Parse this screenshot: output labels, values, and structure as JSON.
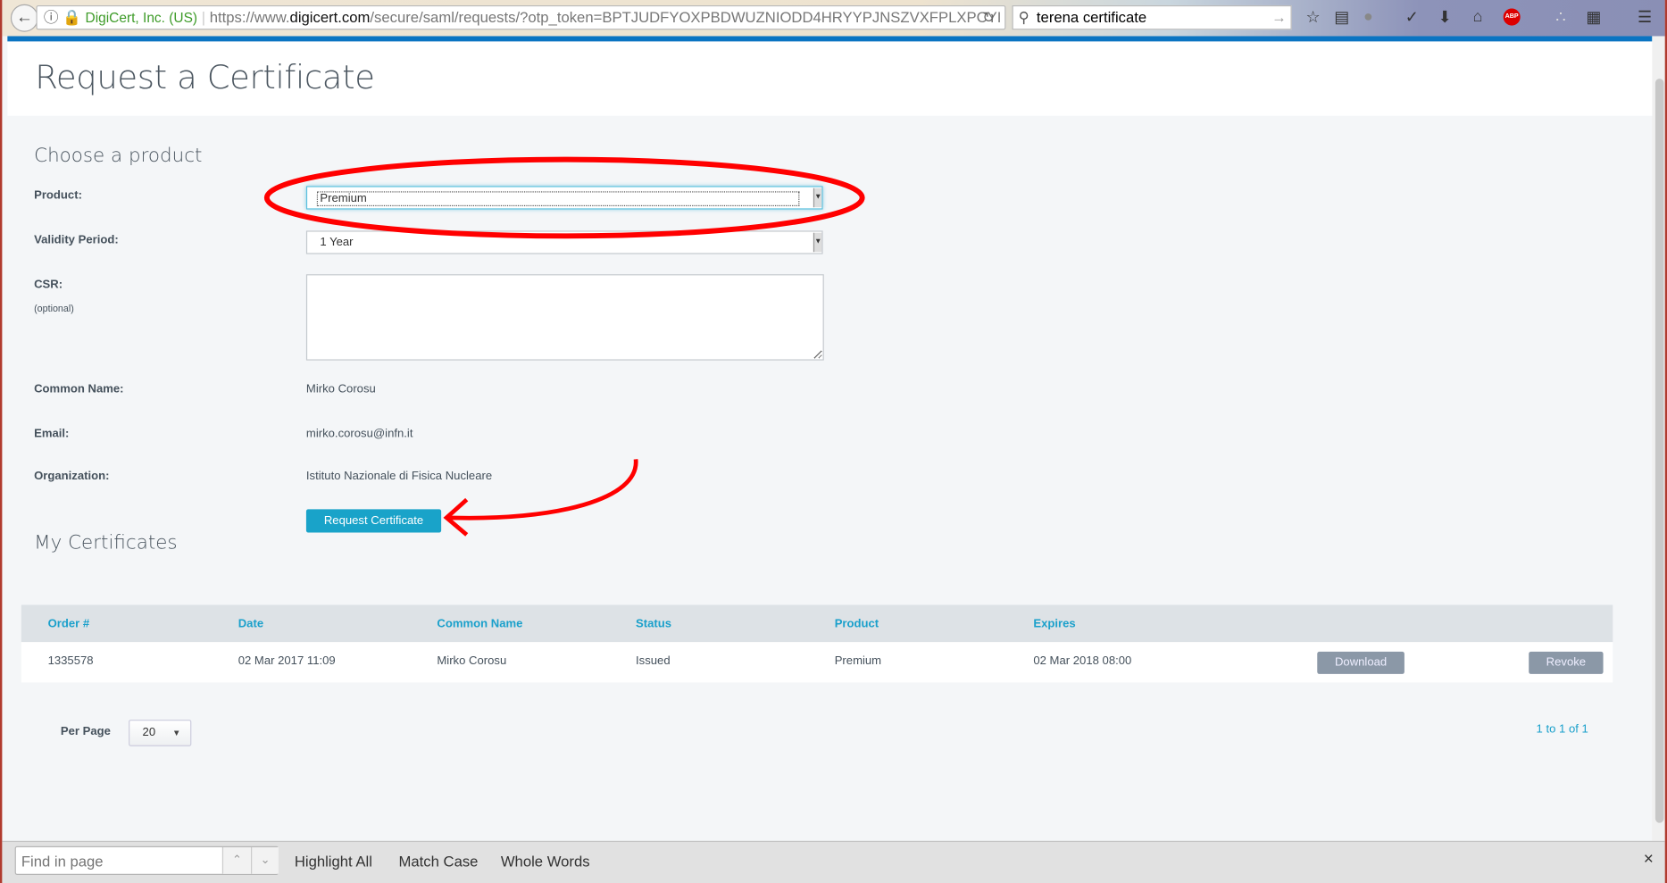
{
  "browser": {
    "identity": "DigiCert, Inc. (US)",
    "url_prefix": "https://www.",
    "url_domain": "digicert.com",
    "url_rest": "/secure/saml/requests/?otp_token=BPTJUDFYOXPBDWUZNIODD4HRYYPJNSZVXFPLXPCYI",
    "search_value": "terena certificate",
    "icons": [
      "back-icon",
      "info-icon",
      "lock-icon",
      "reload-icon",
      "search-icon",
      "star-icon",
      "reading-list-icon",
      "avatar-icon",
      "pocket-icon",
      "download-icon",
      "home-icon",
      "adblock-icon",
      "extension-icon",
      "clipboard-icon",
      "menu-icon"
    ],
    "adblock_label": "ABP"
  },
  "page": {
    "title": "Request a Certificate",
    "form": {
      "heading": "Choose a product",
      "product_label": "Product:",
      "product_value": "Premium",
      "validity_label": "Validity Period:",
      "validity_value": "1 Year",
      "csr_label": "CSR:",
      "csr_hint": "(optional)",
      "csr_value": "",
      "common_name_label": "Common Name:",
      "common_name_value": "Mirko Corosu",
      "email_label": "Email:",
      "email_value": "mirko.corosu@infn.it",
      "org_label": "Organization:",
      "org_value": "Istituto Nazionale di Fisica Nucleare",
      "submit_label": "Request Certificate"
    },
    "certificates": {
      "heading": "My Certificates",
      "columns": [
        "Order #",
        "Date",
        "Common Name",
        "Status",
        "Product",
        "Expires"
      ],
      "rows": [
        {
          "order": "1335578",
          "date": "02 Mar 2017 11:09",
          "common_name": "Mirko Corosu",
          "status": "Issued",
          "product": "Premium",
          "expires": "02 Mar 2018 08:00",
          "download_label": "Download",
          "revoke_label": "Revoke"
        }
      ],
      "per_page_label": "Per Page",
      "per_page_value": "20",
      "pagination": "1 to 1 of 1"
    }
  },
  "findbar": {
    "placeholder": "Find in page",
    "highlight_all": "Highlight All",
    "match_case": "Match Case",
    "whole_words": "Whole Words",
    "close": "×"
  },
  "colors": {
    "accent": "#19a3c9",
    "annotation": "#ff0000",
    "header_blue": "#0a74c2"
  }
}
